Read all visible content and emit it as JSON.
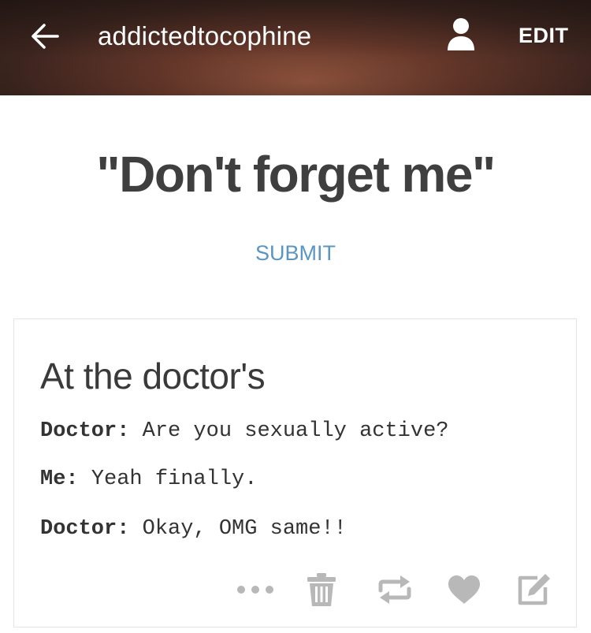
{
  "header": {
    "blog_name": "addictedtocophine",
    "edit_label": "EDIT",
    "icons": {
      "back": "arrow-left-icon",
      "account": "user-icon"
    }
  },
  "page": {
    "title": "\"Don't forget me\"",
    "submit_label": "SUBMIT"
  },
  "post": {
    "title": "At the doctor's",
    "lines": [
      {
        "speaker": "Doctor:",
        "text": " Are you sexually active?"
      },
      {
        "speaker": "Me:",
        "text": " Yeah finally."
      },
      {
        "speaker": "Doctor:",
        "text": " Okay, OMG same!!"
      }
    ],
    "actions": [
      "more-icon",
      "trash-icon",
      "reblog-icon",
      "heart-icon",
      "edit-icon"
    ]
  },
  "colors": {
    "accent_link": "#5b95c2",
    "icon_gray": "#b8b8b8",
    "text_dark": "#3f3f3f"
  }
}
